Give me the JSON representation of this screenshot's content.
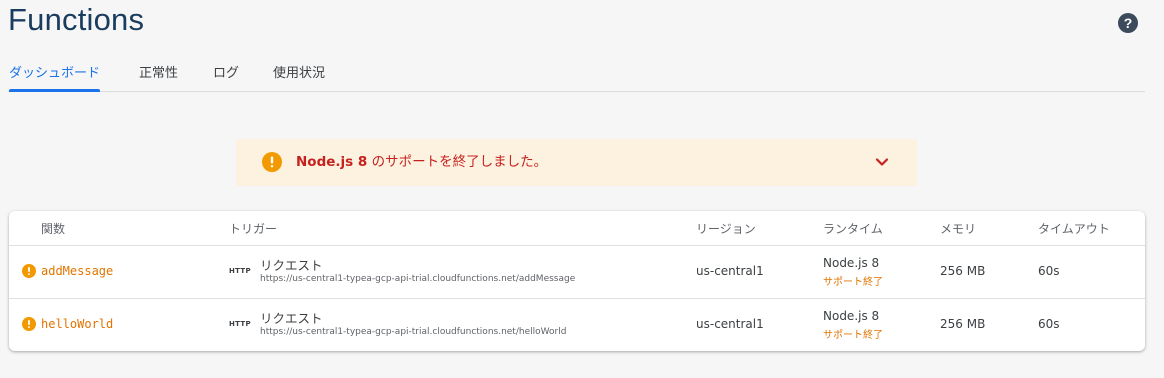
{
  "header": {
    "title": "Functions",
    "help_icon": "help-circle-icon"
  },
  "tabs": [
    {
      "label": "ダッシュボード",
      "active": true
    },
    {
      "label": "正常性",
      "active": false
    },
    {
      "label": "ログ",
      "active": false
    },
    {
      "label": "使用状況",
      "active": false
    }
  ],
  "banner": {
    "icon": "warning-icon",
    "text_bold": "Node.js 8",
    "text_rest": " のサポートを終了しました。",
    "chevron_icon": "chevron-down-icon",
    "color": "#c5221f",
    "background": "#fdf2e0"
  },
  "table": {
    "columns": {
      "name": "関数",
      "trigger": "トリガー",
      "region": "リージョン",
      "runtime": "ランタイム",
      "memory": "メモリ",
      "timeout": "タイムアウト"
    },
    "rows": [
      {
        "name": "addMessage",
        "trigger_type": "HTTP",
        "trigger_label": "リクエスト",
        "trigger_url": "https://us-central1-typea-gcp-api-trial.cloudfunctions.net/addMessage",
        "region": "us-central1",
        "runtime": "Node.js 8",
        "runtime_status": "サポート終了",
        "memory": "256 MB",
        "timeout": "60s"
      },
      {
        "name": "helloWorld",
        "trigger_type": "HTTP",
        "trigger_label": "リクエスト",
        "trigger_url": "https://us-central1-typea-gcp-api-trial.cloudfunctions.net/helloWorld",
        "region": "us-central1",
        "runtime": "Node.js 8",
        "runtime_status": "サポート終了",
        "memory": "256 MB",
        "timeout": "60s"
      }
    ]
  },
  "colors": {
    "accent": "#1a73e8",
    "warning": "#f29900",
    "function_name": "#e37400"
  }
}
